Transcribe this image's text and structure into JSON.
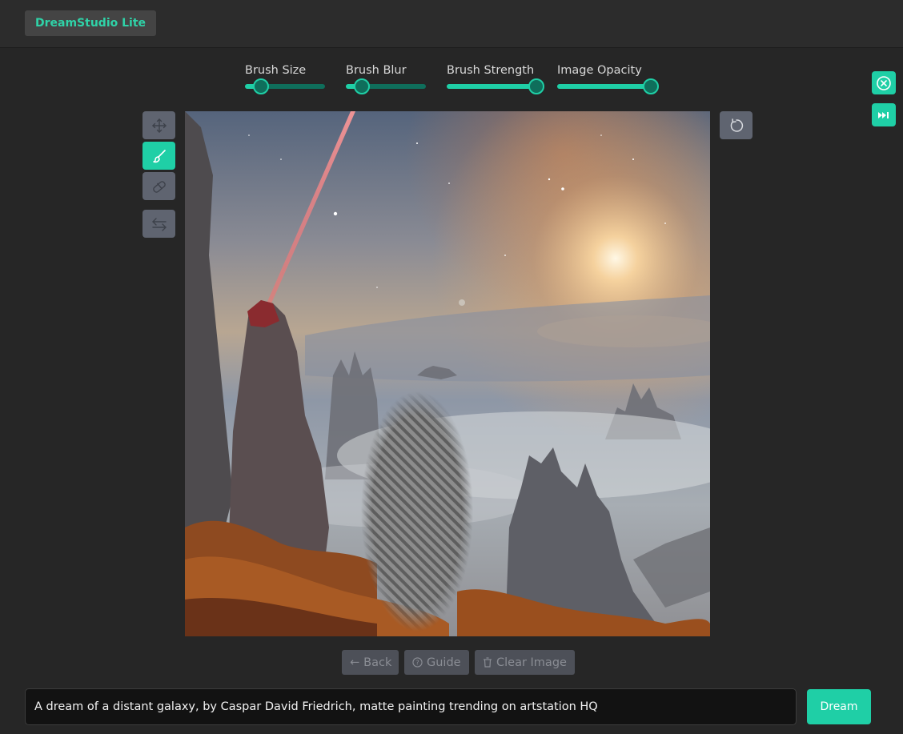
{
  "app": {
    "name": "DreamStudio Lite"
  },
  "sliders": [
    {
      "label": "Brush Size",
      "value": 0.2
    },
    {
      "label": "Brush Blur",
      "value": 0.2
    },
    {
      "label": "Brush Strength",
      "value": 1.0
    },
    {
      "label": "Image Opacity",
      "value": 1.0
    }
  ],
  "tools": [
    {
      "name": "move-tool",
      "icon": "move-icon",
      "active": false
    },
    {
      "name": "brush-tool",
      "icon": "brush-icon",
      "active": true
    },
    {
      "name": "eraser-tool",
      "icon": "eraser-icon",
      "active": false
    },
    {
      "name": "swap-tool",
      "icon": "swap-arrows-icon",
      "active": false
    }
  ],
  "corner_actions": [
    {
      "name": "close-button",
      "icon": "close-circle-icon"
    },
    {
      "name": "skip-button",
      "icon": "fast-forward-icon"
    }
  ],
  "bottom_actions": {
    "back": "Back",
    "guide": "Guide",
    "clear": "Clear Image"
  },
  "prompt": {
    "value": "A dream of a distant galaxy, by Caspar David Friedrich, matte painting trending on artstation HQ"
  },
  "dream_button": "Dream",
  "colors": {
    "accent": "#1fcfa6",
    "accent_dark": "#0f6e5b",
    "background": "#262626",
    "tool_gray": "#5f6470"
  }
}
